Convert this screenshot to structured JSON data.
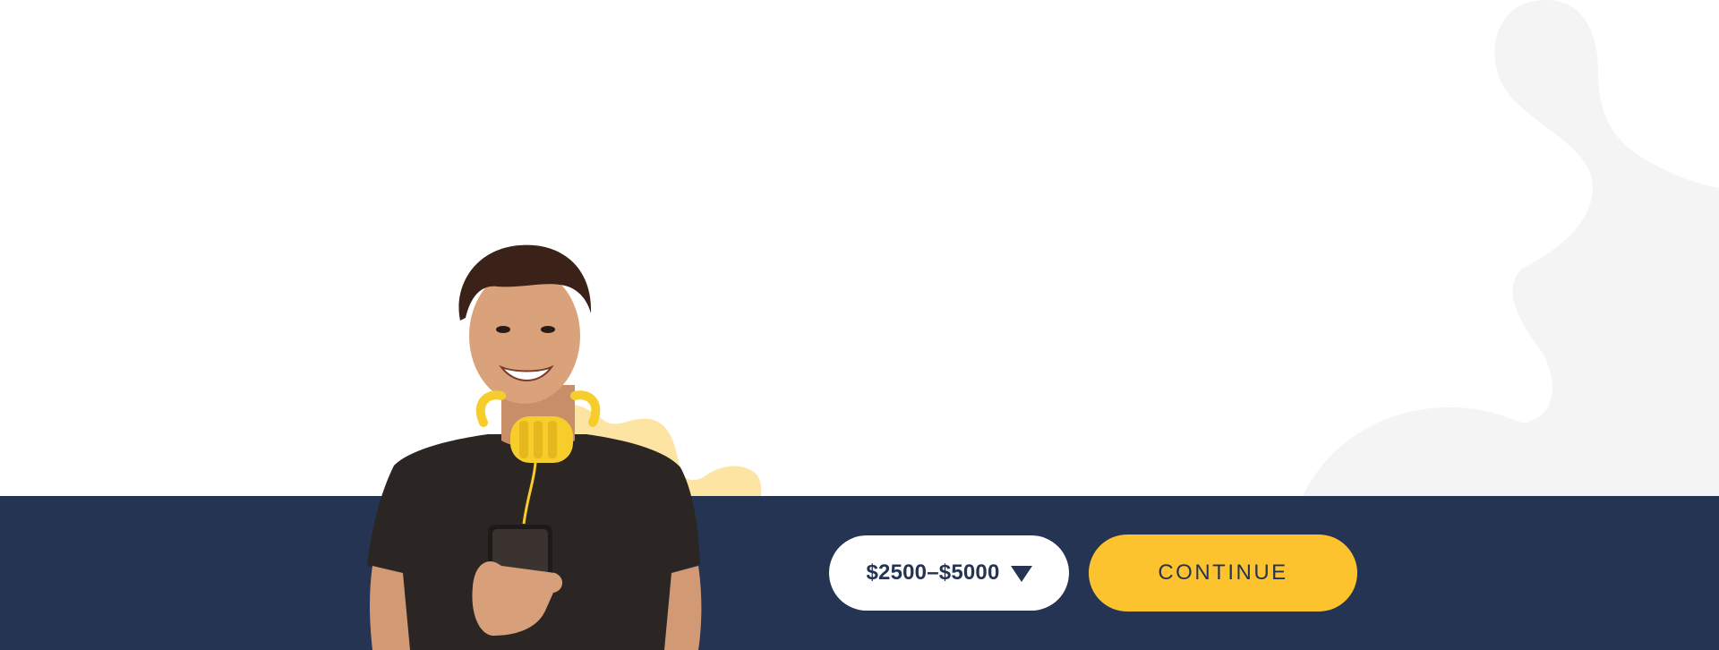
{
  "amount_select": {
    "value": "$2500–$5000",
    "caret_icon": "caret-down-icon"
  },
  "continue_button": {
    "label": "CONTINUE"
  },
  "colors": {
    "navy": "#243452",
    "accent_yellow": "#fcc32f",
    "blob_gray": "#f4f4f4",
    "blob_yellow": "#fde4a3",
    "white": "#ffffff"
  },
  "hero_image": {
    "subject": "smiling man with yellow headphones holding a phone"
  }
}
